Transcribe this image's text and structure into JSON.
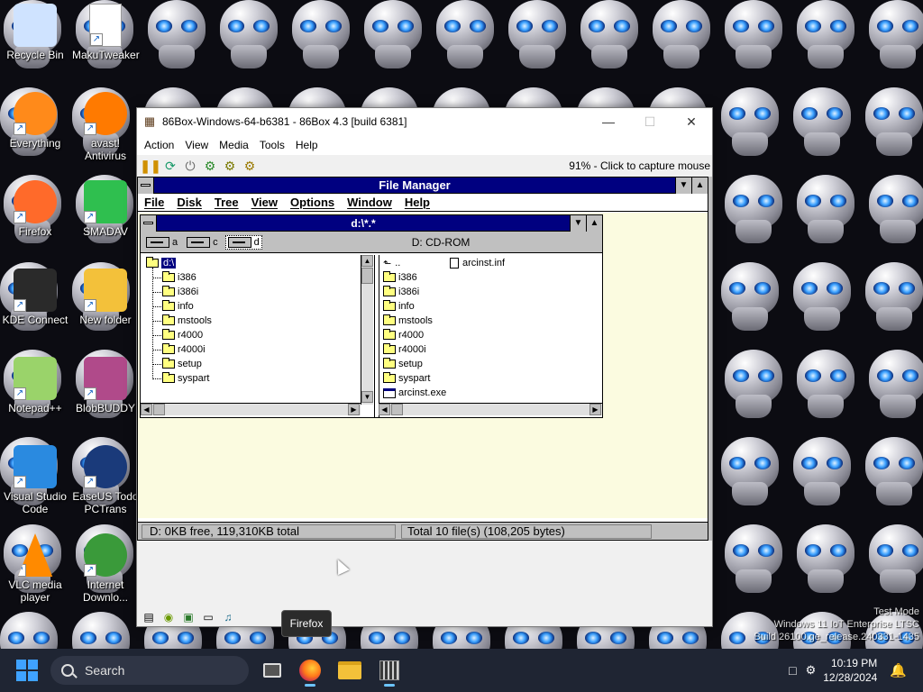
{
  "desktop": {
    "icons": [
      {
        "label": "Recycle Bin",
        "icon": "recycle-bin-icon"
      },
      {
        "label": "MakuTweaker",
        "icon": "blank-file-icon"
      },
      {
        "label": "Everything",
        "icon": "everything-search-icon"
      },
      {
        "label": "avast! Antivirus",
        "icon": "avast-icon"
      },
      {
        "label": "Firefox",
        "icon": "firefox-icon"
      },
      {
        "label": "SMADAV",
        "icon": "smadav-icon"
      },
      {
        "label": "KDE Connect",
        "icon": "kde-connect-icon"
      },
      {
        "label": "New folder",
        "icon": "folder-icon"
      },
      {
        "label": "Notepad++",
        "icon": "notepadpp-icon"
      },
      {
        "label": "BlobBUDDY",
        "icon": "blobbuddy-icon"
      },
      {
        "label": "Visual Studio Code",
        "icon": "vscode-icon"
      },
      {
        "label": "EaseUS Todo PCTrans",
        "icon": "easeus-icon"
      },
      {
        "label": "VLC media player",
        "icon": "vlc-icon"
      },
      {
        "label": "Internet Downlo...",
        "icon": "idm-icon"
      }
    ],
    "watermark": [
      "Test Mode",
      "Windows 11 IoT Enterprise LTSC",
      "Build 26100.ge_release.240331-1435"
    ]
  },
  "emulator": {
    "title": "86Box-Windows-64-b6381 - 86Box 4.3 [build 6381]",
    "menu": [
      "Action",
      "View",
      "Media",
      "Tools",
      "Help"
    ],
    "capture_message": "91% - Click to capture mouse"
  },
  "file_manager": {
    "title": "File Manager",
    "menu": [
      "File",
      "Disk",
      "Tree",
      "View",
      "Options",
      "Window",
      "Help"
    ],
    "child_title": "d:\\*.*",
    "drives": [
      "a",
      "c",
      "d"
    ],
    "drive_label": "D: CD-ROM",
    "tree": {
      "root": "d:\\",
      "folders": [
        "i386",
        "i386i",
        "info",
        "mstools",
        "r4000",
        "r4000i",
        "setup",
        "syspart"
      ]
    },
    "files": {
      "up": "..",
      "top_file": "arcinst.inf",
      "folders": [
        "i386",
        "i386i",
        "info",
        "mstools",
        "r4000",
        "r4000i",
        "setup",
        "syspart"
      ],
      "last_file": "arcinst.exe"
    },
    "status_left": "D: 0KB free,  119,310KB total",
    "status_right": "Total 10 file(s) (108,205 bytes)"
  },
  "tooltip": "Firefox",
  "taskbar": {
    "search_placeholder": "Search",
    "time": "10:19 PM",
    "date": "12/28/2024"
  }
}
